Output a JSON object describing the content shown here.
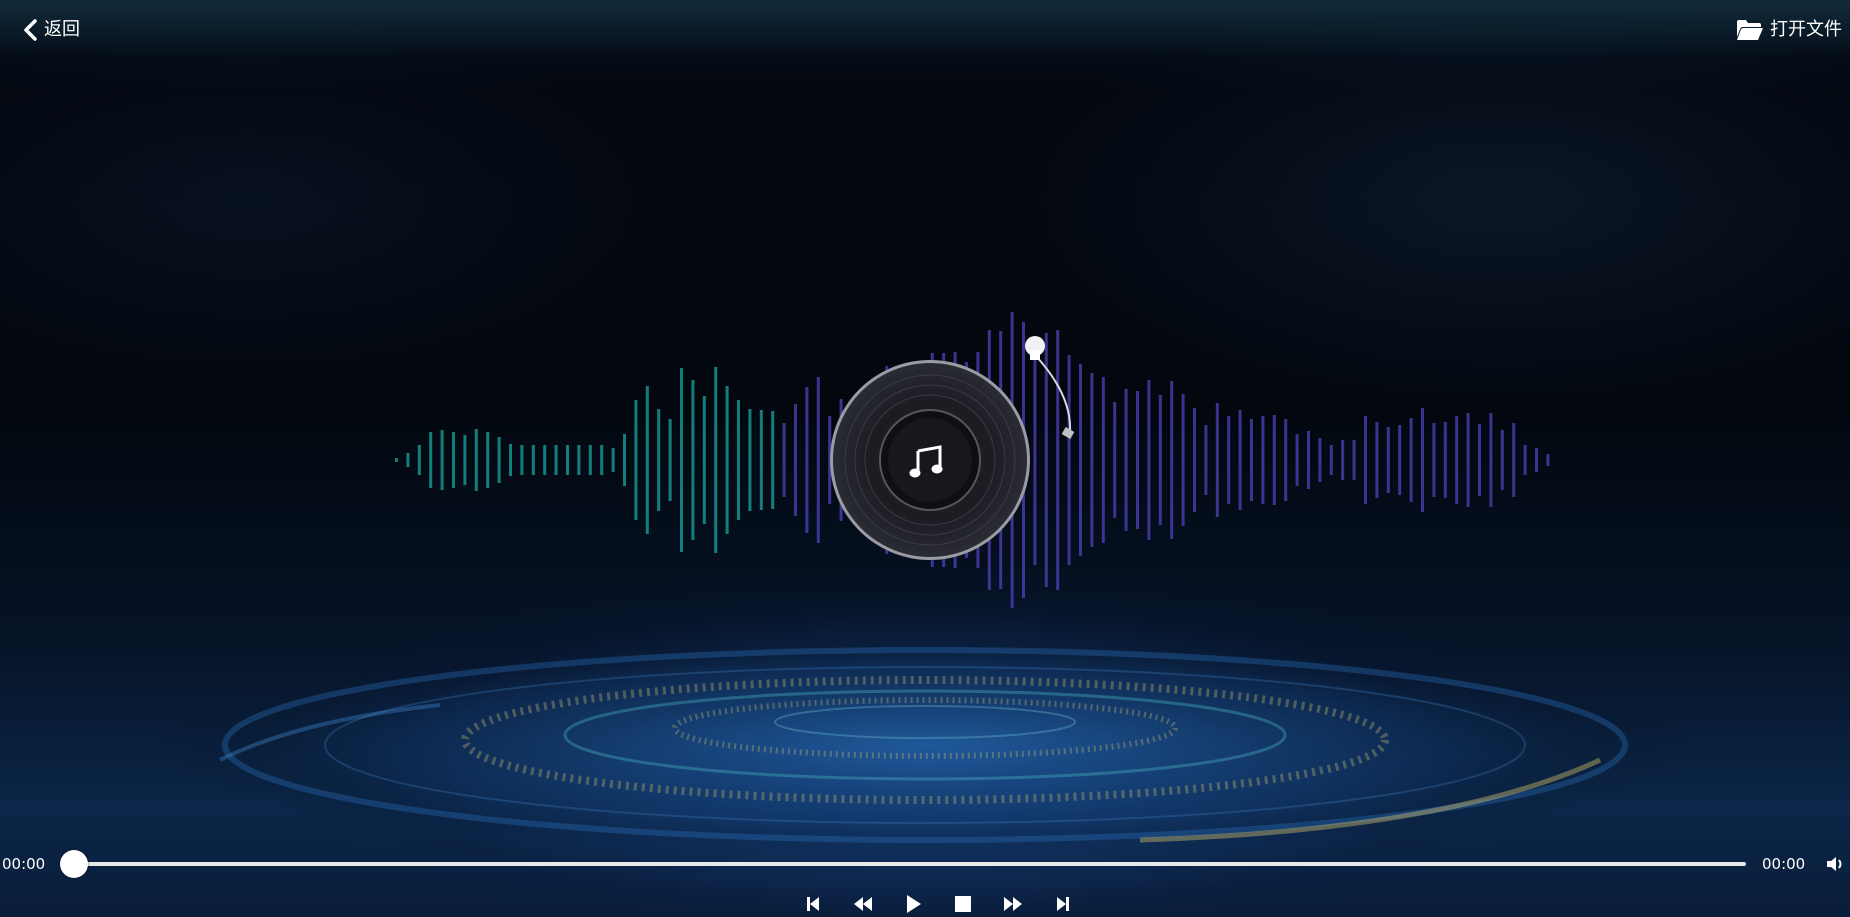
{
  "header": {
    "back_label": "返回",
    "open_file_label": "打开文件"
  },
  "player": {
    "current_time": "00:00",
    "total_time": "00:00",
    "progress_fraction": 0
  },
  "controls": [
    "skip-back",
    "rewind",
    "play",
    "stop",
    "fast-forward",
    "skip-forward"
  ],
  "icons": {
    "back": "chevron-left-icon",
    "open_file": "folder-open-icon",
    "disc_center": "music-note-icon",
    "volume": "volume-icon"
  },
  "colors": {
    "bars_left": "#1aa6a0",
    "bars_right": "#4a3fb0",
    "text": "#ffffff"
  }
}
